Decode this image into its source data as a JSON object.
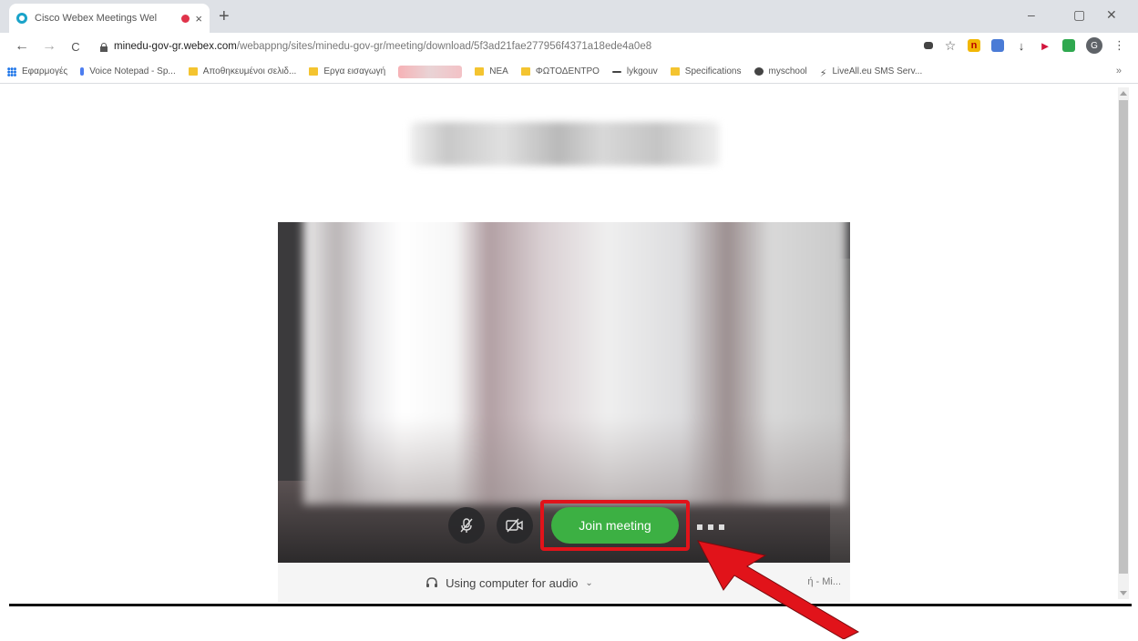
{
  "browser": {
    "tab": {
      "title": "Cisco Webex Meetings Wel",
      "close": "×"
    },
    "new_tab": "+",
    "window_controls": {
      "minimize": "–",
      "restore": "▢",
      "close": "✕"
    },
    "nav": {
      "back": "←",
      "forward": "→",
      "reload": "C"
    },
    "url": {
      "host": "minedu-gov-gr.webex.com",
      "path": "/webappng/sites/minedu-gov-gr/meeting/download/5f3ad21fae277956f4371a18ede4a0e8"
    },
    "avatar_letter": "G",
    "menu": "⋮"
  },
  "bookmarks": {
    "items": [
      {
        "label": "Εφαρμογές",
        "icon": "apps-grid-icon"
      },
      {
        "label": "Voice Notepad - Sp...",
        "icon": "mic-icon"
      },
      {
        "label": "Αποθηκευμένοι σελιδ...",
        "icon": "folder-icon"
      },
      {
        "label": "Εργα εισαγωγή",
        "icon": "folder-icon"
      }
    ],
    "items2": [
      {
        "label": "ΝΕΑ",
        "icon": "folder-icon"
      },
      {
        "label": "ΦΩΤΟΔΕΝΤΡΟ",
        "icon": "folder-icon"
      },
      {
        "label": "lykgouv",
        "icon": "dash-icon"
      },
      {
        "label": "Specifications",
        "icon": "folder-icon"
      },
      {
        "label": "myschool",
        "icon": "globe-icon"
      },
      {
        "label": "LiveAll.eu SMS Serv...",
        "icon": "bolt-icon"
      }
    ],
    "more": "»"
  },
  "meeting": {
    "join_button": "Join meeting",
    "audio_option": "Using computer for audio",
    "audio_right_text": "ή - Mi..."
  },
  "colors": {
    "join_green": "#3cb043",
    "highlight_red": "#e1131a",
    "arrow_red": "#e1131a"
  }
}
